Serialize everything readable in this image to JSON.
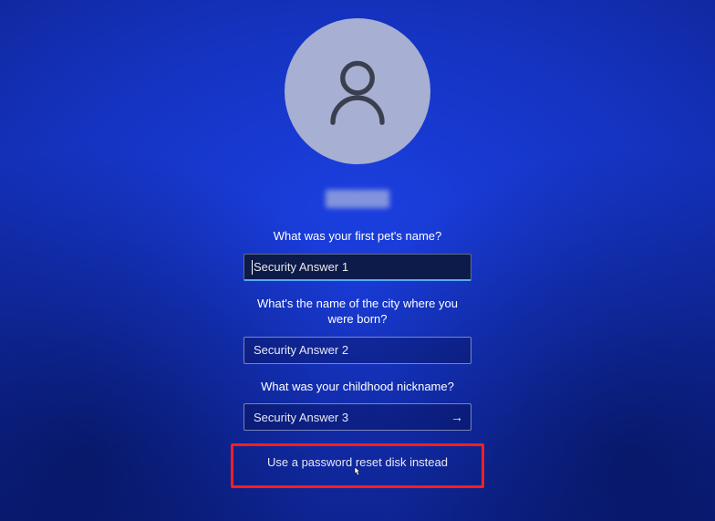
{
  "questions": {
    "q1": "What was your first pet's name?",
    "q2": "What's the name of the city where you were born?",
    "q3": "What was your childhood nickname?"
  },
  "placeholders": {
    "a1": "Security Answer 1",
    "a2": "Security Answer 2",
    "a3": "Security Answer 3"
  },
  "link": "Use a password reset disk instead",
  "icons": {
    "submit_arrow": "→"
  }
}
